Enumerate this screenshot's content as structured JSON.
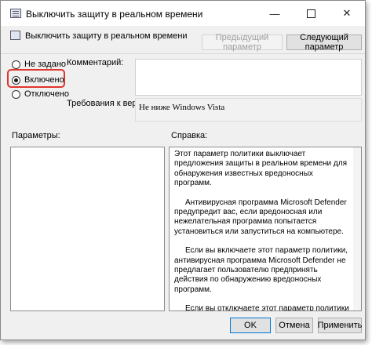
{
  "window": {
    "title": "Выключить защиту в реальном времени",
    "controls": {
      "minimize": "—",
      "close": "✕"
    }
  },
  "header": {
    "policy_name": "Выключить защиту в реальном времени",
    "prev_button": "Предыдущий параметр",
    "next_button": "Следующий параметр"
  },
  "state_options": [
    {
      "label": "Не задано",
      "selected": false
    },
    {
      "label": "Включено",
      "selected": true
    },
    {
      "label": "Отключено",
      "selected": false
    }
  ],
  "comment": {
    "label": "Комментарий:",
    "value": ""
  },
  "supported": {
    "label": "Требования к версии:",
    "value": "Не ниже Windows Vista"
  },
  "params": {
    "label": "Параметры:"
  },
  "help": {
    "label": "Справка:",
    "paragraphs": [
      "Этот параметр политики выключает предложения защиты в реальном времени для обнаружения известных вредоносных программ.",
      "Антивирусная программа Microsoft Defender предупредит вас, если вредоносная или нежелательная программа попытается установиться или запуститься на компьютере.",
      "Если вы включаете этот параметр политики, антивирусная программа Microsoft Defender не предлагает пользователю предпринять действия по обнаружению вредоносных программ.",
      "Если вы отключаете этот параметр политики или не настраиваете его, антивирусная программа Microsoft Defender предлагает пользователям выполнить действия по обнаружению вредоносных программ."
    ]
  },
  "footer": {
    "ok": "OK",
    "cancel": "Отмена",
    "apply": "Применить"
  },
  "colors": {
    "highlight": "#e0352d",
    "default_button_border": "#0078d7"
  }
}
